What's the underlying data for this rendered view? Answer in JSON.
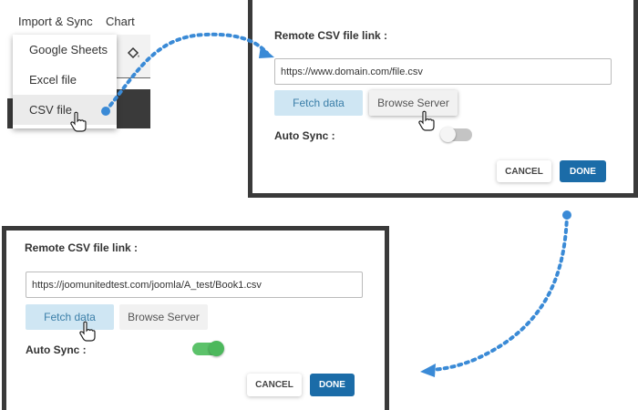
{
  "menubar": {
    "import_sync": "Import & Sync",
    "chart": "Chart"
  },
  "dropdown": {
    "items": [
      "Google Sheets",
      "Excel file",
      "CSV file"
    ]
  },
  "dialog_top": {
    "label": "Remote CSV file link :",
    "url_value": "https://www.domain.com/file.csv",
    "fetch_label": "Fetch data",
    "browse_label": "Browse Server",
    "auto_sync_label": "Auto Sync :",
    "auto_sync_on": false,
    "cancel_label": "CANCEL",
    "done_label": "DONE"
  },
  "dialog_bottom": {
    "label": "Remote CSV file link :",
    "url_value": "https://joomunitedtest.com/joomla/A_test/Book1.csv",
    "fetch_label": "Fetch data",
    "browse_label": "Browse Server",
    "auto_sync_label": "Auto Sync :",
    "auto_sync_on": true,
    "cancel_label": "CANCEL",
    "done_label": "DONE"
  },
  "colors": {
    "accent_blue": "#1b6ca8",
    "fetch_bg": "#cfe6f3",
    "arrow_blue": "#3a8ad6",
    "toggle_on": "#5cc26a",
    "toggle_off": "#c4c4c4",
    "frame_dark": "#3a3a3a"
  },
  "icons": [
    "paint-bucket-icon",
    "hand-cursor-icon",
    "dotted-arrow-icon"
  ]
}
